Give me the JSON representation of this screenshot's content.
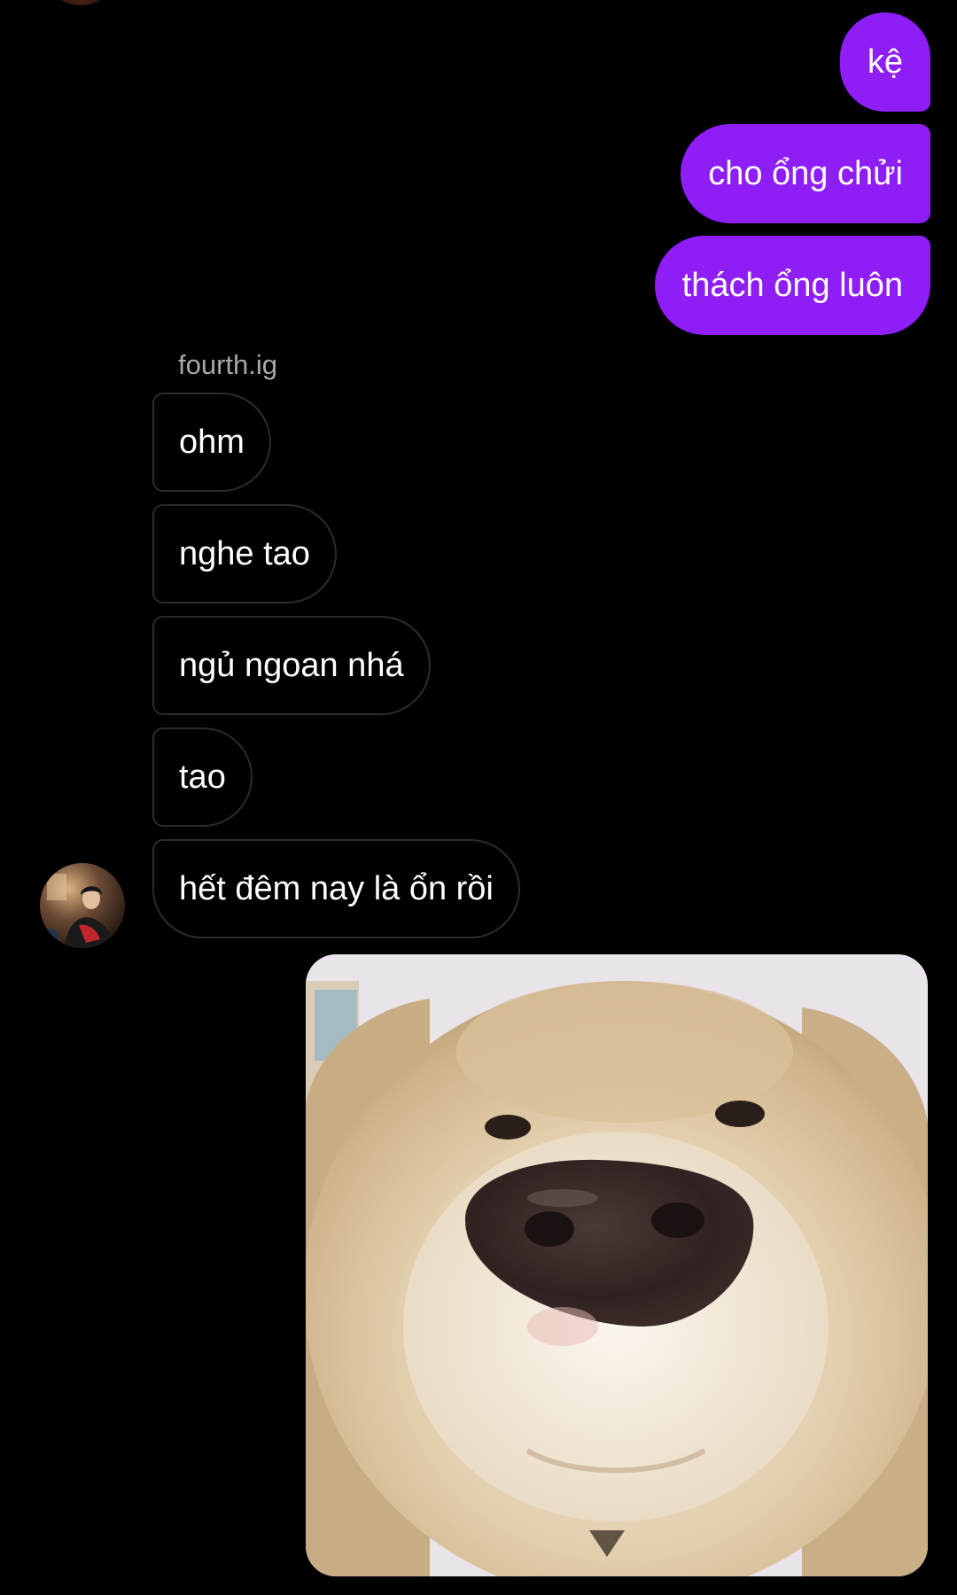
{
  "sent_messages": [
    {
      "text": "kệ"
    },
    {
      "text": "cho ổng chửi"
    },
    {
      "text": "thách ổng luôn"
    }
  ],
  "received": {
    "sender_name": "fourth.ig",
    "messages": [
      {
        "text": "ohm"
      },
      {
        "text": "nghe tao"
      },
      {
        "text": "ngủ ngoan nhá"
      },
      {
        "text": "tao"
      },
      {
        "text": "hết đêm nay là ổn rồi"
      }
    ],
    "avatar_icon": "profile-photo-avatar"
  },
  "sent_image": {
    "subject": "close-up-dog-face-photo"
  },
  "colors": {
    "background": "#000000",
    "sent_bubble": "#8e1df6",
    "received_border": "#2b2b2b",
    "sender_name": "#a8a8a8"
  }
}
